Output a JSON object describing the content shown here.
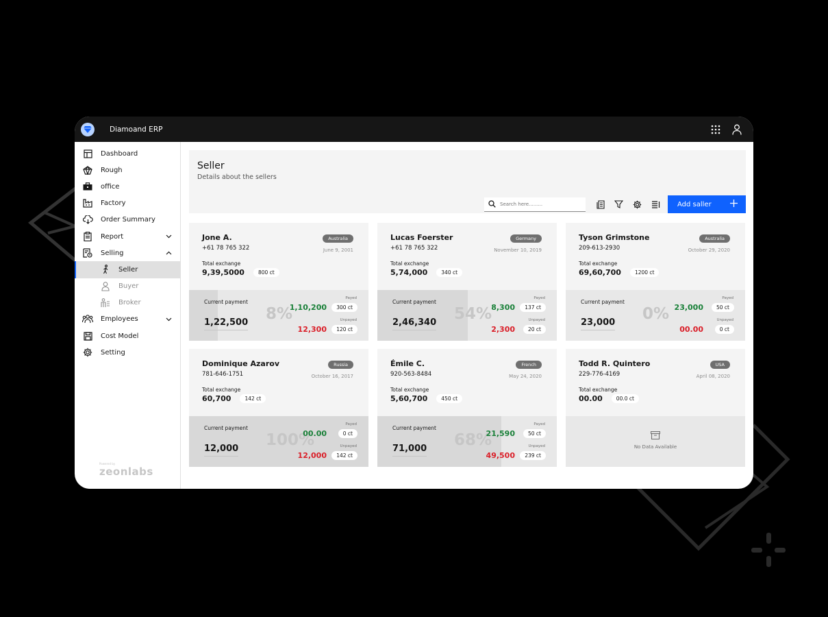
{
  "app": {
    "title": "Diamoand ERP",
    "logo_icon": "diamond-icon"
  },
  "topbar": {
    "icons": [
      "grid-icon",
      "user-icon"
    ]
  },
  "sidebar": {
    "items": [
      {
        "label": "Dashboard",
        "icon": "dashboard-icon"
      },
      {
        "label": "Rough",
        "icon": "gem-icon"
      },
      {
        "label": "office",
        "icon": "briefcase-icon"
      },
      {
        "label": "Factory",
        "icon": "factory-icon"
      },
      {
        "label": "Order Summary",
        "icon": "cloud-download-icon"
      },
      {
        "label": "Report",
        "icon": "clipboard-icon",
        "expandable": true
      },
      {
        "label": "Selling",
        "icon": "receipt-icon",
        "expandable": true,
        "expanded": true
      },
      {
        "label": "Seller",
        "icon": "person-icon",
        "sub": true,
        "active": true
      },
      {
        "label": "Buyer",
        "icon": "person-icon",
        "sub": true
      },
      {
        "label": "Broker",
        "icon": "broker-icon",
        "sub": true
      },
      {
        "label": "Employees",
        "icon": "group-icon",
        "expandable": true
      },
      {
        "label": "Cost Model",
        "icon": "save-icon"
      },
      {
        "label": "Setting",
        "icon": "gear-icon"
      }
    ],
    "powered_by": "Powered by",
    "brand": "zeonlabs"
  },
  "page": {
    "title": "Seller",
    "subtitle": "Details about the sellers",
    "search_placeholder": "Search here.........",
    "add_button": "Add saller"
  },
  "labels": {
    "total_exchange": "Total exchange",
    "current_payment": "Current payment",
    "payed": "Payed",
    "unpayed": "Unpayed",
    "no_data": "No Data Available"
  },
  "colors": {
    "accent": "#0f62fe",
    "paid": "#198038",
    "unpaid": "#da1e28",
    "tag": "#6f6f6f"
  },
  "sellers": [
    {
      "name": "Jone A.",
      "phone": "+61 78 765 322",
      "country": "Australia",
      "date": "June 9, 2001",
      "total": "9,39,5000",
      "total_ct": "800 ct",
      "current": "1,22,500",
      "percent": "8%",
      "percent_value": 0.16,
      "payed": "1,10,200",
      "payed_ct": "300 ct",
      "unpayed": "12,300",
      "unpayed_ct": "120 ct"
    },
    {
      "name": "Lucas Foerster",
      "phone": "+61 78 765 322",
      "country": "Germany",
      "date": "November 10, 2019",
      "total": "5,74,000",
      "total_ct": "340 ct",
      "current": "2,46,340",
      "percent": "54%",
      "percent_value": 0.505,
      "payed": "8,300",
      "payed_ct": "137 ct",
      "unpayed": "2,300",
      "unpayed_ct": "20 ct"
    },
    {
      "name": "Tyson Grimstone",
      "phone": "209-613-2930",
      "country": "Australia",
      "date": "October 29, 2020",
      "total": "69,60,700",
      "total_ct": "1200 ct",
      "current": "23,000",
      "percent": "0%",
      "percent_value": 0,
      "payed": "23,000",
      "payed_ct": "50 ct",
      "unpayed": "00.00",
      "unpayed_ct": "0 ct"
    },
    {
      "name": "Dominique Azarov",
      "phone": "781-646-1751",
      "country": "Russia",
      "date": "October 16, 2017",
      "total": "60,700",
      "total_ct": "142 ct",
      "current": "12,000",
      "percent": "100%",
      "percent_value": 1.0,
      "payed": "00.00",
      "payed_ct": "0 ct",
      "unpayed": "12,000",
      "unpayed_ct": "142 ct"
    },
    {
      "name": "Émile C.",
      "phone": "920-563-8484",
      "country": "French",
      "date": "May 24, 2020",
      "total": "5,60,700",
      "total_ct": "450 ct",
      "current": "71,000",
      "percent": "68%",
      "percent_value": 0.69,
      "payed": "21,590",
      "payed_ct": "50 ct",
      "unpayed": "49,500",
      "unpayed_ct": "239 ct"
    },
    {
      "name": "Todd R. Quintero",
      "phone": "229-776-4169",
      "country": "USA",
      "date": "April 08, 2020",
      "total": "00.00",
      "total_ct": "00.0 ct",
      "no_data": true
    }
  ]
}
